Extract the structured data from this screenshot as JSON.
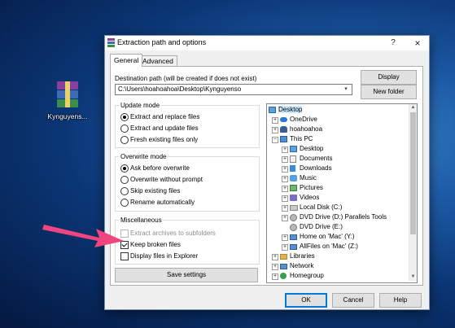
{
  "desktop": {
    "icon_label": "Kynguyens..."
  },
  "dialog": {
    "title": "Extraction path and options",
    "title_help": "?",
    "title_close": "×",
    "tabs": [
      "General",
      "Advanced"
    ],
    "destination_label": "Destination path (will be created if does not exist)",
    "destination_value": "C:\\Users\\hoahoahoa\\Desktop\\Kynguyenso",
    "display_button": "Display",
    "new_folder_button": "New folder",
    "update_mode": {
      "title": "Update mode",
      "options": [
        "Extract and replace files",
        "Extract and update files",
        "Fresh existing files only"
      ],
      "selected": 0
    },
    "overwrite_mode": {
      "title": "Overwrite mode",
      "options": [
        "Ask before overwrite",
        "Overwrite without prompt",
        "Skip existing files",
        "Rename automatically"
      ],
      "selected": 0
    },
    "misc": {
      "title": "Miscellaneous",
      "options": [
        {
          "label": "Extract archives to subfolders",
          "checked": false,
          "disabled": true
        },
        {
          "label": "Keep broken files",
          "checked": true,
          "disabled": false
        },
        {
          "label": "Display files in Explorer",
          "checked": false,
          "disabled": false
        }
      ]
    },
    "save_settings_button": "Save settings",
    "tree": [
      {
        "label": "Desktop",
        "icon": "desktop-icon",
        "level": 0,
        "expander": "",
        "selected": true
      },
      {
        "label": "OneDrive",
        "icon": "cloud-icon",
        "level": 1,
        "expander": "+"
      },
      {
        "label": "hoahoahoa",
        "icon": "user-icon",
        "level": 1,
        "expander": "+"
      },
      {
        "label": "This PC",
        "icon": "computer-icon",
        "level": 1,
        "expander": "−"
      },
      {
        "label": "Desktop",
        "icon": "desktop-icon",
        "level": 2,
        "expander": "+"
      },
      {
        "label": "Documents",
        "icon": "documents-icon",
        "level": 2,
        "expander": "+"
      },
      {
        "label": "Downloads",
        "icon": "downloads-icon",
        "level": 2,
        "expander": "+"
      },
      {
        "label": "Music",
        "icon": "music-icon",
        "level": 2,
        "expander": "+"
      },
      {
        "label": "Pictures",
        "icon": "pictures-icon",
        "level": 2,
        "expander": "+"
      },
      {
        "label": "Videos",
        "icon": "videos-icon",
        "level": 2,
        "expander": "+"
      },
      {
        "label": "Local Disk (C:)",
        "icon": "drive-icon",
        "level": 2,
        "expander": "+"
      },
      {
        "label": "DVD Drive (D:) Parallels Tools",
        "icon": "disc-icon",
        "level": 2,
        "expander": "+"
      },
      {
        "label": "DVD Drive (E:)",
        "icon": "disc-icon",
        "level": 2,
        "expander": ""
      },
      {
        "label": "Home on 'Mac' (Y:)",
        "icon": "network-drive-icon",
        "level": 2,
        "expander": "+"
      },
      {
        "label": "AllFiles on 'Mac' (Z:)",
        "icon": "network-drive-icon",
        "level": 2,
        "expander": "+"
      },
      {
        "label": "Libraries",
        "icon": "library-icon",
        "level": 1,
        "expander": "+"
      },
      {
        "label": "Network",
        "icon": "network-icon",
        "level": 1,
        "expander": "+"
      },
      {
        "label": "Homegroup",
        "icon": "homegroup-icon",
        "level": 1,
        "expander": "+"
      }
    ],
    "ok_button": "OK",
    "cancel_button": "Cancel",
    "help_button": "Help"
  },
  "colors": {
    "arrow": "#f0457e",
    "accent": "#0078d7",
    "selection": "#cce8ff"
  }
}
